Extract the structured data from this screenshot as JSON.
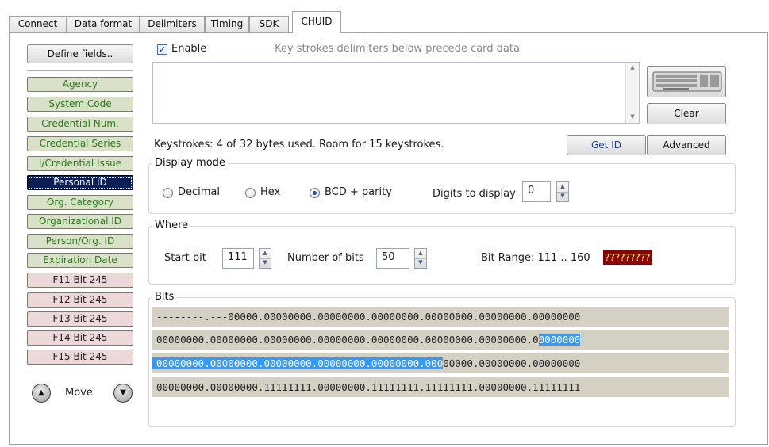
{
  "tabs": [
    {
      "label": "Connect"
    },
    {
      "label": "Data format"
    },
    {
      "label": "Delimiters"
    },
    {
      "label": "Timing"
    },
    {
      "label": "SDK"
    },
    {
      "label": "CHUID"
    }
  ],
  "active_tab": "CHUID",
  "left": {
    "define_fields_label": "Define fields..",
    "fields": [
      {
        "label": "Agency",
        "style": "green"
      },
      {
        "label": "System Code",
        "style": "green"
      },
      {
        "label": "Credential Num.",
        "style": "green"
      },
      {
        "label": "Credential Series",
        "style": "green"
      },
      {
        "label": "I/Credential Issue",
        "style": "green"
      },
      {
        "label": "Personal ID",
        "style": "selected"
      },
      {
        "label": "Org. Category",
        "style": "green"
      },
      {
        "label": "Organizational ID",
        "style": "green"
      },
      {
        "label": "Person/Org. ID",
        "style": "green"
      },
      {
        "label": "Expiration Date",
        "style": "green"
      },
      {
        "label": "F11 Bit 245",
        "style": "pink"
      },
      {
        "label": "F12 Bit 245",
        "style": "pink"
      },
      {
        "label": "F13 Bit 245",
        "style": "pink"
      },
      {
        "label": "F14 Bit 245",
        "style": "pink"
      },
      {
        "label": "F15 Bit 245",
        "style": "pink"
      }
    ],
    "move_label": "Move",
    "move_up_icon": "up-arrow-icon",
    "move_down_icon": "down-arrow-icon"
  },
  "enable": {
    "checked": true,
    "label": "Enable"
  },
  "keystrokes_hint": "Key strokes delimiters below precede card data",
  "keystrokes_textarea_value": "",
  "keyboard_icon": "keyboard-icon",
  "buttons": {
    "clear": "Clear",
    "get_id": "Get ID",
    "advanced": "Advanced"
  },
  "keystrokes_status": "Keystrokes: 4 of 32 bytes used. Room for 15 keystrokes.",
  "display_mode": {
    "legend": "Display mode",
    "options": [
      "Decimal",
      "Hex",
      "BCD + parity"
    ],
    "selected": "BCD + parity",
    "digits_label": "Digits to display",
    "digits_value": "0"
  },
  "where": {
    "legend": "Where",
    "start_bit_label": "Start bit",
    "start_bit_value": "111",
    "num_bits_label": "Number of bits",
    "num_bits_value": "50",
    "bit_range_text": "Bit Range: 111 .. 160",
    "bit_range_badge": "?????????"
  },
  "bits": {
    "legend": "Bits",
    "rows": [
      {
        "pre": "--------.---00000.00000000.00000000.00000000.00000000.00000000.00000000",
        "hl": "",
        "post": ""
      },
      {
        "pre": "00000000.00000000.00000000.00000000.00000000.00000000.00000000.0",
        "hl": "0000000",
        "post": ""
      },
      {
        "pre": "",
        "hl": "00000000.00000000.00000000.00000000.00000000.000",
        "post": "00000.00000000.00000000"
      },
      {
        "pre": "00000000.00000000.11111111.00000000.11111111.11111111.00000000.11111111",
        "hl": "",
        "post": ""
      }
    ]
  },
  "colors": {
    "field_green_bg": "#d9e2c8",
    "field_green_text": "#2a7a1a",
    "field_pink_bg": "#ecd8d8",
    "selected_field_bg": "#0c1f55",
    "bits_bg": "#d5d0c4",
    "highlight": "#3399ff",
    "badge_bg": "#8b0000",
    "badge_text": "#ffff66"
  }
}
